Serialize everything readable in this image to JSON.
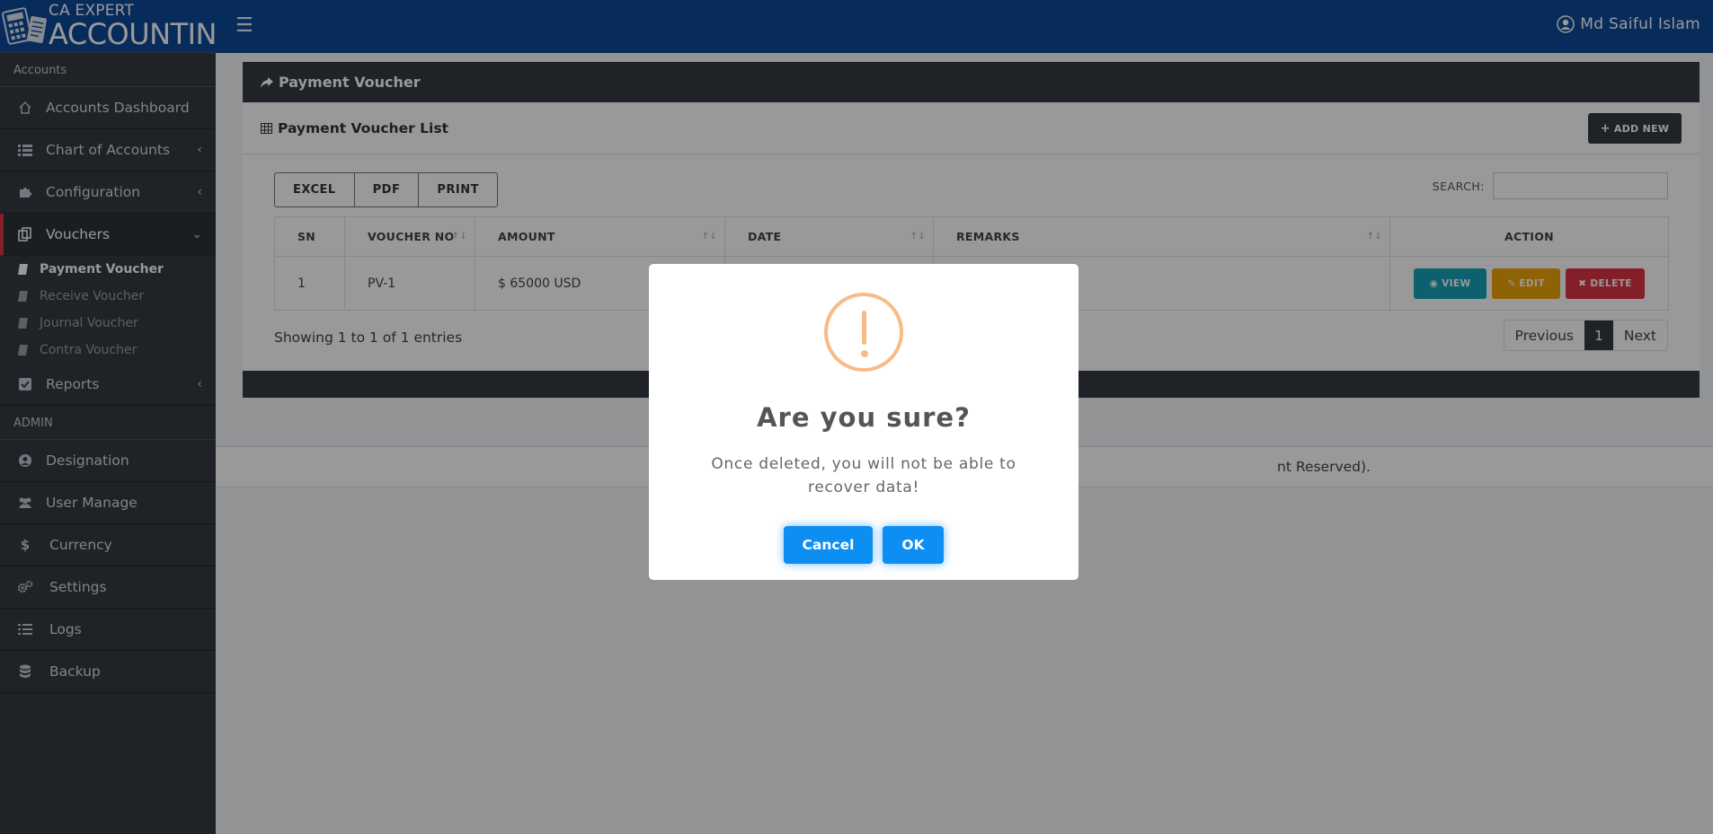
{
  "brand": {
    "line1": "CA EXPERT",
    "line2": "ACCOUNTING"
  },
  "sidebar": {
    "section_accounts": "Accounts",
    "items": [
      {
        "label": "Accounts Dashboard",
        "icon": "home-icon"
      },
      {
        "label": "Chart of Accounts",
        "icon": "list-icon"
      },
      {
        "label": "Configuration",
        "icon": "puzzle-icon"
      },
      {
        "label": "Vouchers",
        "icon": "copy-icon"
      }
    ],
    "vouchers_sub": [
      {
        "label": "Payment Voucher"
      },
      {
        "label": "Receive Voucher"
      },
      {
        "label": "Journal Voucher"
      },
      {
        "label": "Contra Voucher"
      }
    ],
    "reports": {
      "label": "Reports",
      "icon": "check-square-icon"
    },
    "section_admin": "ADMIN",
    "admin_items": [
      {
        "label": "Designation",
        "icon": "user-circle-icon"
      },
      {
        "label": "User Manage",
        "icon": "users-icon"
      },
      {
        "label": "Currency",
        "icon": "dollar-icon"
      },
      {
        "label": "Settings",
        "icon": "cogs-icon"
      },
      {
        "label": "Logs",
        "icon": "list-icon"
      },
      {
        "label": "Backup",
        "icon": "database-icon"
      }
    ]
  },
  "topbar": {
    "user_name": "Md Saiful Islam"
  },
  "card": {
    "title": "Payment Voucher",
    "list_title": "Payment Voucher List",
    "add_new": "ADD NEW",
    "tools": [
      "EXCEL",
      "PDF",
      "PRINT"
    ],
    "search_label": "SEARCH:",
    "columns": [
      "SN",
      "VOUCHER NO",
      "AMOUNT",
      "DATE",
      "REMARKS",
      "ACTION"
    ],
    "rows": [
      {
        "sn": "1",
        "voucher_no": "PV-1",
        "amount": "$ 65000 USD",
        "date": "",
        "remarks": ""
      }
    ],
    "actions": {
      "view": "VIEW",
      "edit": "EDIT",
      "delete": "DELETE"
    },
    "showing": "Showing 1 to 1 of 1 entries",
    "pager": {
      "prev": "Previous",
      "page": "1",
      "next": "Next"
    }
  },
  "footer": {
    "text": "nt Reserved)."
  },
  "modal": {
    "title": "Are you sure?",
    "text": "Once deleted, you will not be able to recover data!",
    "cancel": "Cancel",
    "ok": "OK",
    "icon_color": "#f8bb86",
    "button_color": "#0d8ef3"
  }
}
